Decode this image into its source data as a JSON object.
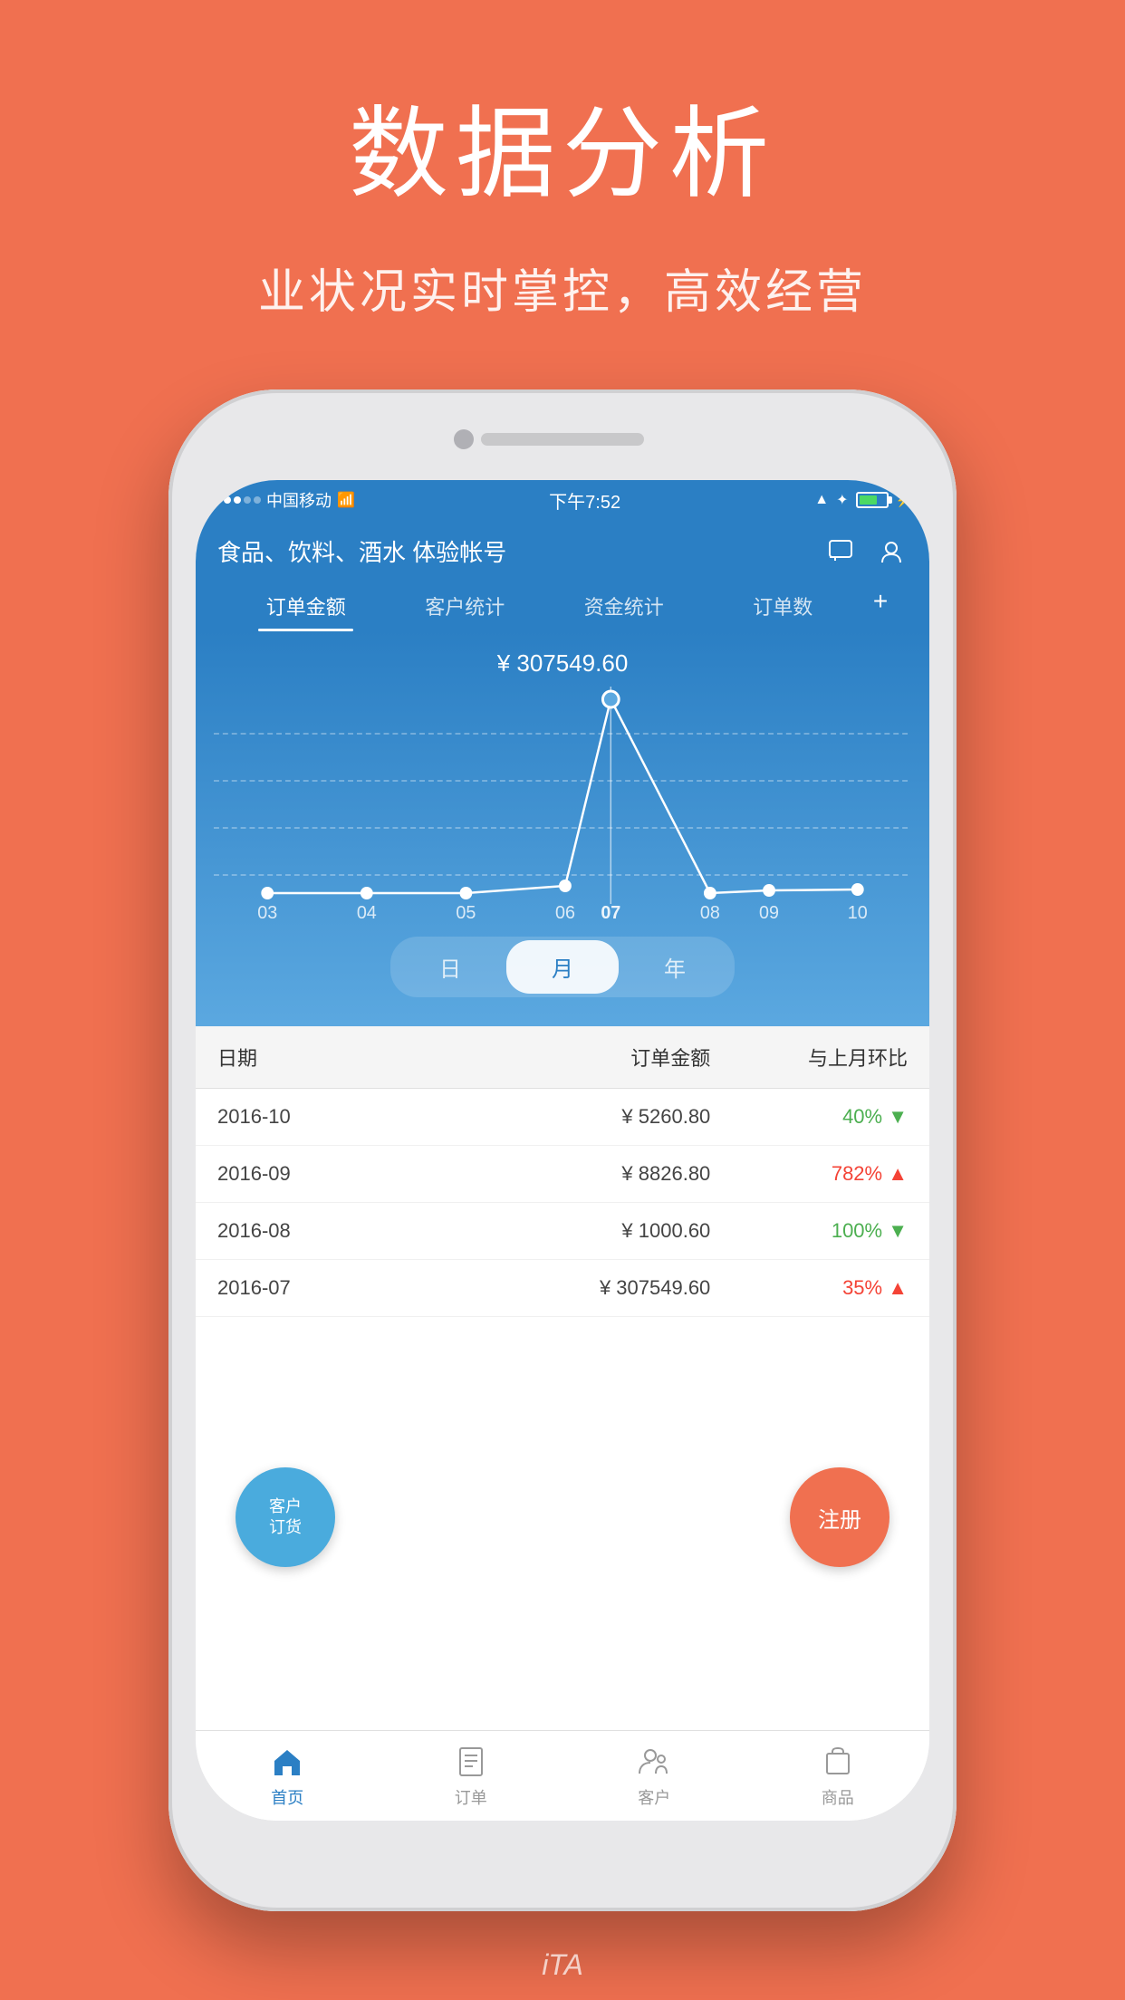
{
  "hero": {
    "title": "数据分析",
    "subtitle": "业状况实时掌控，高效经营"
  },
  "status_bar": {
    "carrier": "中国移动",
    "wifi": "wifi",
    "time": "下午7:52",
    "location": "↑",
    "bluetooth": "✦"
  },
  "app": {
    "title": "食品、饮料、酒水 体验帐号",
    "tabs": [
      {
        "label": "订单金额",
        "active": true
      },
      {
        "label": "客户统计",
        "active": false
      },
      {
        "label": "资金统计",
        "active": false
      },
      {
        "label": "订单数",
        "active": false
      }
    ],
    "chart": {
      "value_label": "¥ 307549.60",
      "x_labels": [
        "03",
        "04",
        "05",
        "06",
        "07",
        "08",
        "09",
        "10"
      ],
      "period_buttons": [
        {
          "label": "日",
          "active": false
        },
        {
          "label": "月",
          "active": true
        },
        {
          "label": "年",
          "active": false
        }
      ]
    },
    "table": {
      "headers": [
        "日期",
        "订单金额",
        "与上月环比"
      ],
      "rows": [
        {
          "date": "2016-10",
          "amount": "¥ 5260.80",
          "change": "40%",
          "direction": "down"
        },
        {
          "date": "2016-09",
          "amount": "¥ 8826.80",
          "change": "782%",
          "direction": "up"
        },
        {
          "date": "2016-08",
          "amount": "¥ 1000.60",
          "change": "100%",
          "direction": "down"
        },
        {
          "date": "2016-07",
          "amount": "¥ 307549.60",
          "change": "35%",
          "direction": "up"
        }
      ]
    },
    "bottom_nav": [
      {
        "label": "首页",
        "active": true,
        "icon": "home"
      },
      {
        "label": "订单",
        "active": false,
        "icon": "order"
      },
      {
        "label": "客户",
        "active": false,
        "icon": "customer"
      },
      {
        "label": "商品",
        "active": false,
        "icon": "product"
      }
    ],
    "float_customer": "客户\n订货",
    "float_register": "注册"
  },
  "bottom_text": "iTA"
}
